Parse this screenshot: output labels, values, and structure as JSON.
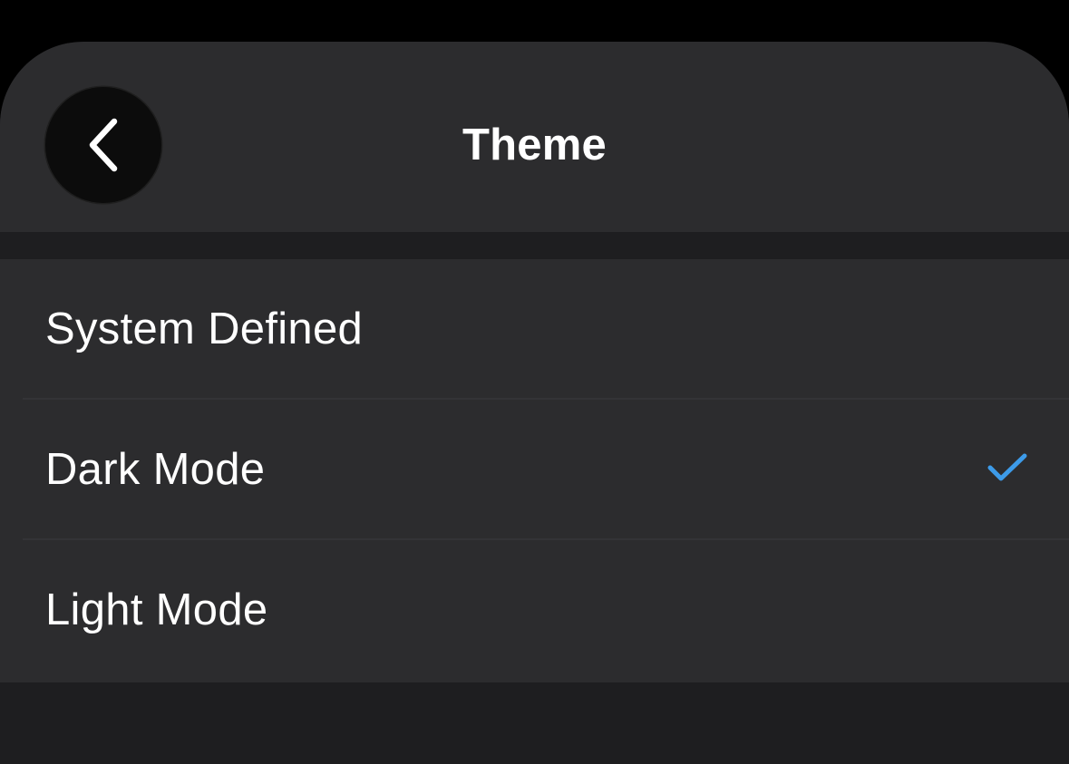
{
  "header": {
    "title": "Theme",
    "back_icon": "chevron-left-icon"
  },
  "options": [
    {
      "label": "System Defined",
      "selected": false
    },
    {
      "label": "Dark Mode",
      "selected": true
    },
    {
      "label": "Light Mode",
      "selected": false
    }
  ],
  "colors": {
    "background": "#000000",
    "sheet": "#1e1e20",
    "surface": "#2c2c2e",
    "accent": "#3d9be9",
    "text": "#ffffff"
  },
  "icons": {
    "selected": "checkmark-icon"
  }
}
